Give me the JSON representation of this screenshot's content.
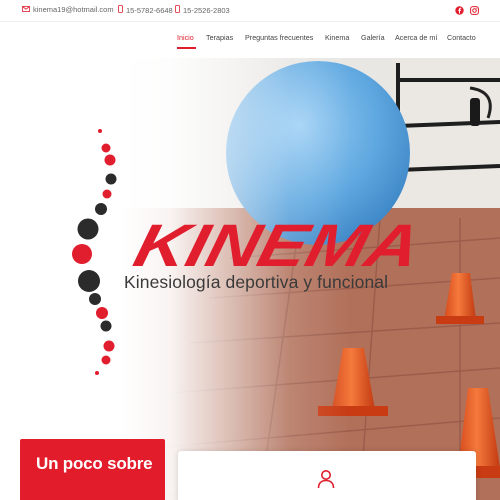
{
  "topbar": {
    "email": "kinema19@hotmail.com",
    "phone1": "15-5782-6648",
    "phone2": "15-2526-2803",
    "icons": [
      "envelope-icon",
      "phone-icon",
      "phone-icon",
      "facebook-icon",
      "instagram-icon"
    ]
  },
  "nav": {
    "items": [
      {
        "label": "Inicio"
      },
      {
        "label": "Terapias"
      },
      {
        "label": "Preguntas frecuentes"
      },
      {
        "label": "Kinema"
      },
      {
        "label": "Galería"
      },
      {
        "label": "Acerca de mí"
      },
      {
        "label": "Contacto"
      }
    ],
    "active_index": 0
  },
  "hero": {
    "logo_text": "KINEMA",
    "tagline": "Kinesiología deportiva y funcional"
  },
  "cards": {
    "red_card_title": "Un poco sobre",
    "white_card_icon": "user-icon"
  },
  "colors": {
    "accent": "#e01e2e",
    "text_dark": "#3a3a3a",
    "dot_dark": "#2b2b2b"
  }
}
